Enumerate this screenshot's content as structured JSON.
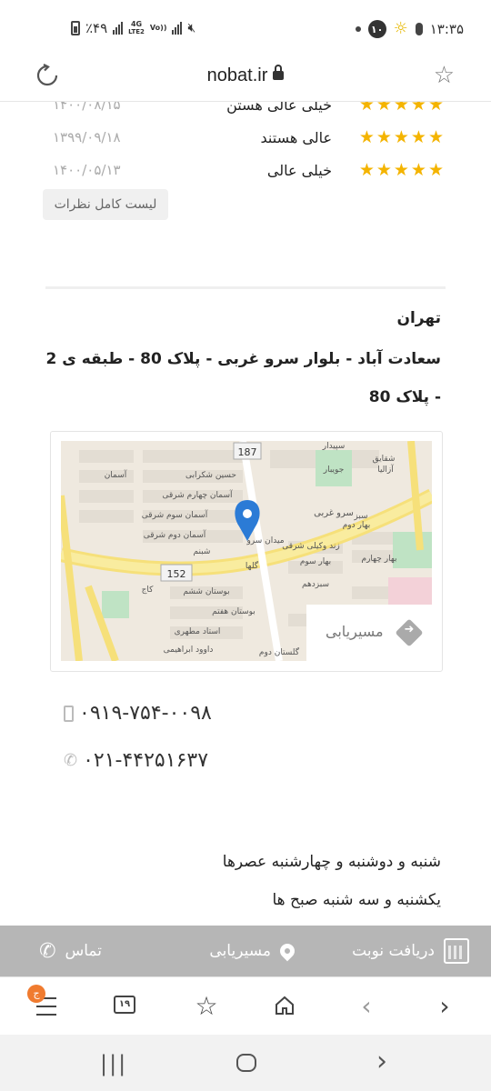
{
  "status_bar": {
    "time": "۱۳:۳۵",
    "battery": "٪۴۹",
    "network_top": "4G",
    "network_bottom": "LTE2",
    "volte": "Vo))",
    "notification_count": "۱۰"
  },
  "browser": {
    "url": "nobat.ir"
  },
  "reviews": [
    {
      "stars": "★★★★★",
      "text": "خیلی عالی هستن",
      "date": "۱۴۰۰/۰۸/۱۵"
    },
    {
      "stars": "★★★★★",
      "text": "عالی هستند",
      "date": "۱۳۹۹/۰۹/۱۸"
    },
    {
      "stars": "★★★★★",
      "text": "خیلی عالی",
      "date": "۱۴۰۰/۰۵/۱۳"
    }
  ],
  "more_reviews_label": "لیست کامل نظرات",
  "location": {
    "city": "تهران",
    "address": "سعادت آباد - بلوار سرو غربی - پلاک 80 - طبقه ی 2 - پلاک 80"
  },
  "map": {
    "route_label": "مسیریابی",
    "labels": [
      "187",
      "152",
      "سرو غربی",
      "آسمان",
      "بهار دوم",
      "بهار سوم",
      "سپیدار",
      "میدان سرو",
      "گلها",
      "بوستان ششم",
      "بوستان هفتم",
      "استاد مطهری",
      "آسمان چهارم شرقی",
      "آسمان سوم شرقی",
      "آسمان دوم شرقی",
      "شبنم",
      "حسین شکرابی",
      "سبزدهم",
      "شقایق",
      "زند وکیلی شرقی",
      "بهار چهارم",
      "گلستان دوم",
      "داوود ابراهیمی",
      "کاج",
      "جویبار",
      "آزالیا",
      "سبز"
    ]
  },
  "phones": {
    "mobile": "۰۹۱۹-۷۵۴-۰۰۹۸",
    "landline": "۰۲۱-۴۴۲۵۱۶۳۷"
  },
  "hours": [
    "شنبه و دوشنبه و چهارشنبه عصرها",
    "یکشنبه و سه شنبه صبح ها"
  ],
  "action_bar": {
    "appointment": "دریافت نوبت",
    "route": "مسیریابی",
    "contact": "تماس"
  },
  "browser_toolbar": {
    "tab_count": "۱۹",
    "menu_badge": "ج"
  },
  "colors": {
    "star": "#f4b400",
    "action_bar": "#b6b6b6",
    "map_pin": "#2b7bd6",
    "badge": "#f07b2f"
  }
}
